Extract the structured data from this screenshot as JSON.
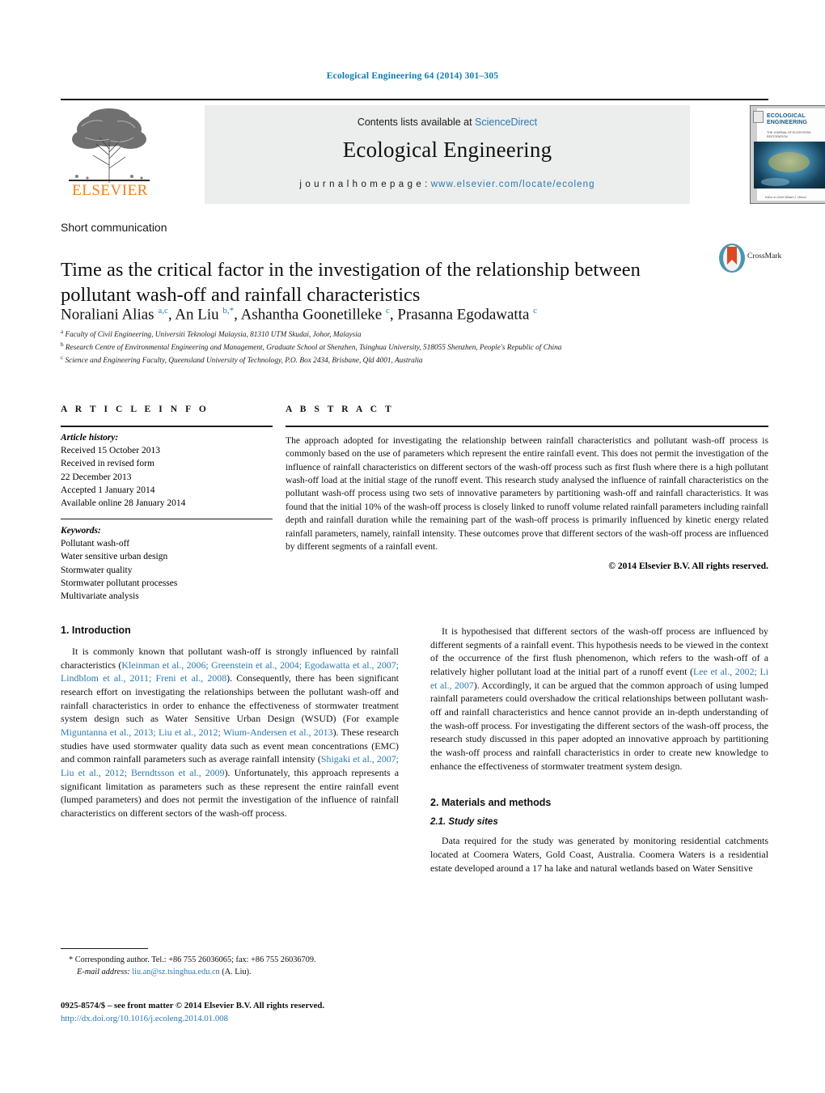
{
  "running_head": "Ecological Engineering 64 (2014) 301–305",
  "masthead": {
    "contents_prefix": "Contents lists available at ",
    "contents_link": "ScienceDirect",
    "journal_title": "Ecological Engineering",
    "homepage_label": "j o u r n a l   h o m e p a g e :",
    "homepage_url": "www.elsevier.com/locate/ecoleng",
    "publisher": "ELSEVIER",
    "cover": {
      "title": "ECOLOGICAL ENGINEERING",
      "subtitle": "THE JOURNAL OF ECOSYSTEM RESTORATION",
      "footer": "Editor-in-Chief\nWilliam J. Mitsch"
    }
  },
  "article": {
    "type": "Short communication",
    "title": "Time as the critical factor in the investigation of the relationship between pollutant wash-off and rainfall characteristics",
    "crossmark_label": "CrossMark",
    "authors_html": "Noraliani Alias <sup>a,c</sup>, An Liu <sup>b,<span style=\"color:#2a7ab0\">*</span></sup>, Ashantha Goonetilleke <sup>c</sup>, Prasanna Egodawatta <sup>c</sup>",
    "affiliations": [
      {
        "marker": "a",
        "text": "Faculty of Civil Engineering, Universiti Teknologi Malaysia, 81310 UTM Skudai, Johor, Malaysia"
      },
      {
        "marker": "b",
        "text": "Research Centre of Environmental Engineering and Management, Graduate School at Shenzhen, Tsinghua University, 518055 Shenzhen, People's Republic of China"
      },
      {
        "marker": "c",
        "text": "Science and Engineering Faculty, Queensland University of Technology, P.O. Box 2434, Brisbane, Qld 4001, Australia"
      }
    ]
  },
  "article_info": {
    "heading": "A R T I C L E    I N F O",
    "history_label": "Article history:",
    "history": [
      "Received 15 October 2013",
      "Received in revised form",
      "22 December 2013",
      "Accepted 1 January 2014",
      "Available online 28 January 2014"
    ],
    "keywords_label": "Keywords:",
    "keywords": [
      "Pollutant wash-off",
      "Water sensitive urban design",
      "Stormwater quality",
      "Stormwater pollutant processes",
      "Multivariate analysis"
    ]
  },
  "abstract": {
    "heading": "A B S T R A C T",
    "text": "The approach adopted for investigating the relationship between rainfall characteristics and pollutant wash-off process is commonly based on the use of parameters which represent the entire rainfall event. This does not permit the investigation of the influence of rainfall characteristics on different sectors of the wash-off process such as first flush where there is a high pollutant wash-off load at the initial stage of the runoff event. This research study analysed the influence of rainfall characteristics on the pollutant wash-off process using two sets of innovative parameters by partitioning wash-off and rainfall characteristics. It was found that the initial 10% of the wash-off process is closely linked to runoff volume related rainfall parameters including rainfall depth and rainfall duration while the remaining part of the wash-off process is primarily influenced by kinetic energy related rainfall parameters, namely, rainfall intensity. These outcomes prove that different sectors of the wash-off process are influenced by different segments of a rainfall event.",
    "copyright": "© 2014 Elsevier B.V. All rights reserved."
  },
  "body": {
    "section1_heading": "1.  Introduction",
    "section1_p1_html": "It is commonly known that pollutant wash-off is strongly influenced by rainfall characteristics (<span class=\"ref\">Kleinman et al., 2006; Greenstein et al., 2004; Egodawatta et al., 2007; Lindblom et al., 2011; Freni et al., 2008</span>). Consequently, there has been significant research effort on investigating the relationships between the pollutant wash-off and rainfall characteristics in order to enhance the effectiveness of stormwater treatment system design such as Water Sensitive Urban Design (WSUD) (For example <span class=\"ref\">Miguntanna et al., 2013; Liu et al., 2012; Wium-Andersen et al., 2013</span>). These research studies have used stormwater quality data such as event mean concentrations (EMC) and common rainfall parameters such as average rainfall intensity (<span class=\"ref\">Shigaki et al., 2007; Liu et al., 2012; Berndtsson et al., 2009</span>). Unfortunately, this approach represents a significant limitation as parameters such as these represent the entire rainfall event (lumped parameters) and does not permit the investigation of the influence of rainfall characteristics on different sectors of the wash-off process.",
    "section1_p2_html": "It is hypothesised that different sectors of the wash-off process are influenced by different segments of a rainfall event. This hypothesis needs to be viewed in the context of the occurrence of the first flush phenomenon, which refers to the wash-off of a relatively higher pollutant load at the initial part of a runoff event (<span class=\"ref\">Lee et al., 2002; Li et al., 2007</span>). Accordingly, it can be argued that the common approach of using lumped rainfall parameters could overshadow the critical relationships between pollutant wash-off and rainfall characteristics and hence cannot provide an in-depth understanding of the wash-off process. For investigating the different sectors of the wash-off process, the research study discussed in this paper adopted an innovative approach by partitioning the wash-off process and rainfall characteristics in order to create new knowledge to enhance the effectiveness of stormwater treatment system design.",
    "section2_heading": "2.  Materials and methods",
    "section2_1_heading": "2.1.  Study sites",
    "section2_1_p1": "Data required for the study was generated by monitoring residential catchments located at Coomera Waters, Gold Coast, Australia. Coomera Waters is a residential estate developed around a 17 ha lake and natural wetlands based on Water Sensitive"
  },
  "footnotes": {
    "corresponding_html": "* Corresponding author. Tel.: +86 755 26036065; fax: +86 755 26036709.",
    "email_html": "<i>E-mail address:</i> <span class=\"ref\">liu.an@sz.tsinghua.edu.cn</span> (A. Liu).",
    "issn_html": "0925-8574/$ – see front matter © 2014 Elsevier B.V. All rights reserved.",
    "doi": "http://dx.doi.org/10.1016/j.ecoleng.2014.01.008"
  },
  "colors": {
    "link": "#2a7ab0",
    "elsevier_orange": "#f08019",
    "rule": "#1a1a1a",
    "banner_bg": "#eceded"
  }
}
